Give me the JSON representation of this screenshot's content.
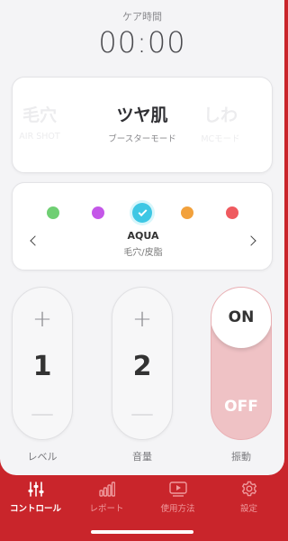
{
  "timer": {
    "label": "ケア時間",
    "value": "00:00"
  },
  "modes": [
    {
      "title": "毛穴",
      "sub": "AIR SHOT",
      "active": false
    },
    {
      "title": "ツヤ肌",
      "sub": "ブースターモード",
      "active": true
    },
    {
      "title": "しわ",
      "sub": "MCモード",
      "active": false
    }
  ],
  "colors": {
    "swatches": [
      "#6fcf73",
      "#c457e8",
      "#3ec7e4",
      "#f2a13c",
      "#ef5a5f"
    ],
    "selected_index": 2,
    "name": "AQUA",
    "sub": "毛穴/皮脂"
  },
  "controls": {
    "level": {
      "plus": "+",
      "value": "1",
      "minus": "—",
      "label": "レベル"
    },
    "volume": {
      "plus": "+",
      "value": "2",
      "minus": "—",
      "label": "音量"
    },
    "vibration": {
      "on": "ON",
      "off": "OFF",
      "label": "振動",
      "state": "ON"
    }
  },
  "tabs": [
    {
      "label": "コントロール",
      "icon": "sliders-icon",
      "active": true
    },
    {
      "label": "レポート",
      "icon": "bar-chart-icon",
      "active": false
    },
    {
      "label": "使用方法",
      "icon": "play-video-icon",
      "active": false
    },
    {
      "label": "設定",
      "icon": "gear-icon",
      "active": false
    }
  ],
  "theme": {
    "accent": "#c9252b",
    "aqua": "#3ec7e4"
  }
}
